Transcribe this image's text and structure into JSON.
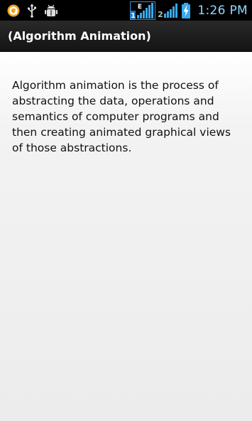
{
  "status_bar": {
    "time": "1:26 PM",
    "sim1_label": "1",
    "sim1_network": "E",
    "sim2_label": "2",
    "icons": [
      "notification-app-icon",
      "usb-icon",
      "android-debug-icon",
      "sim1-signal-icon",
      "sim2-signal-icon",
      "battery-charging-icon"
    ],
    "clock_color": "#8fd8ff"
  },
  "action_bar": {
    "title": "(Algorithm Animation)"
  },
  "content": {
    "text": "Algorithm animation is the process of abstracting the data, operations and semantics of computer programs and then creating animated graphical views of those abstractions."
  }
}
